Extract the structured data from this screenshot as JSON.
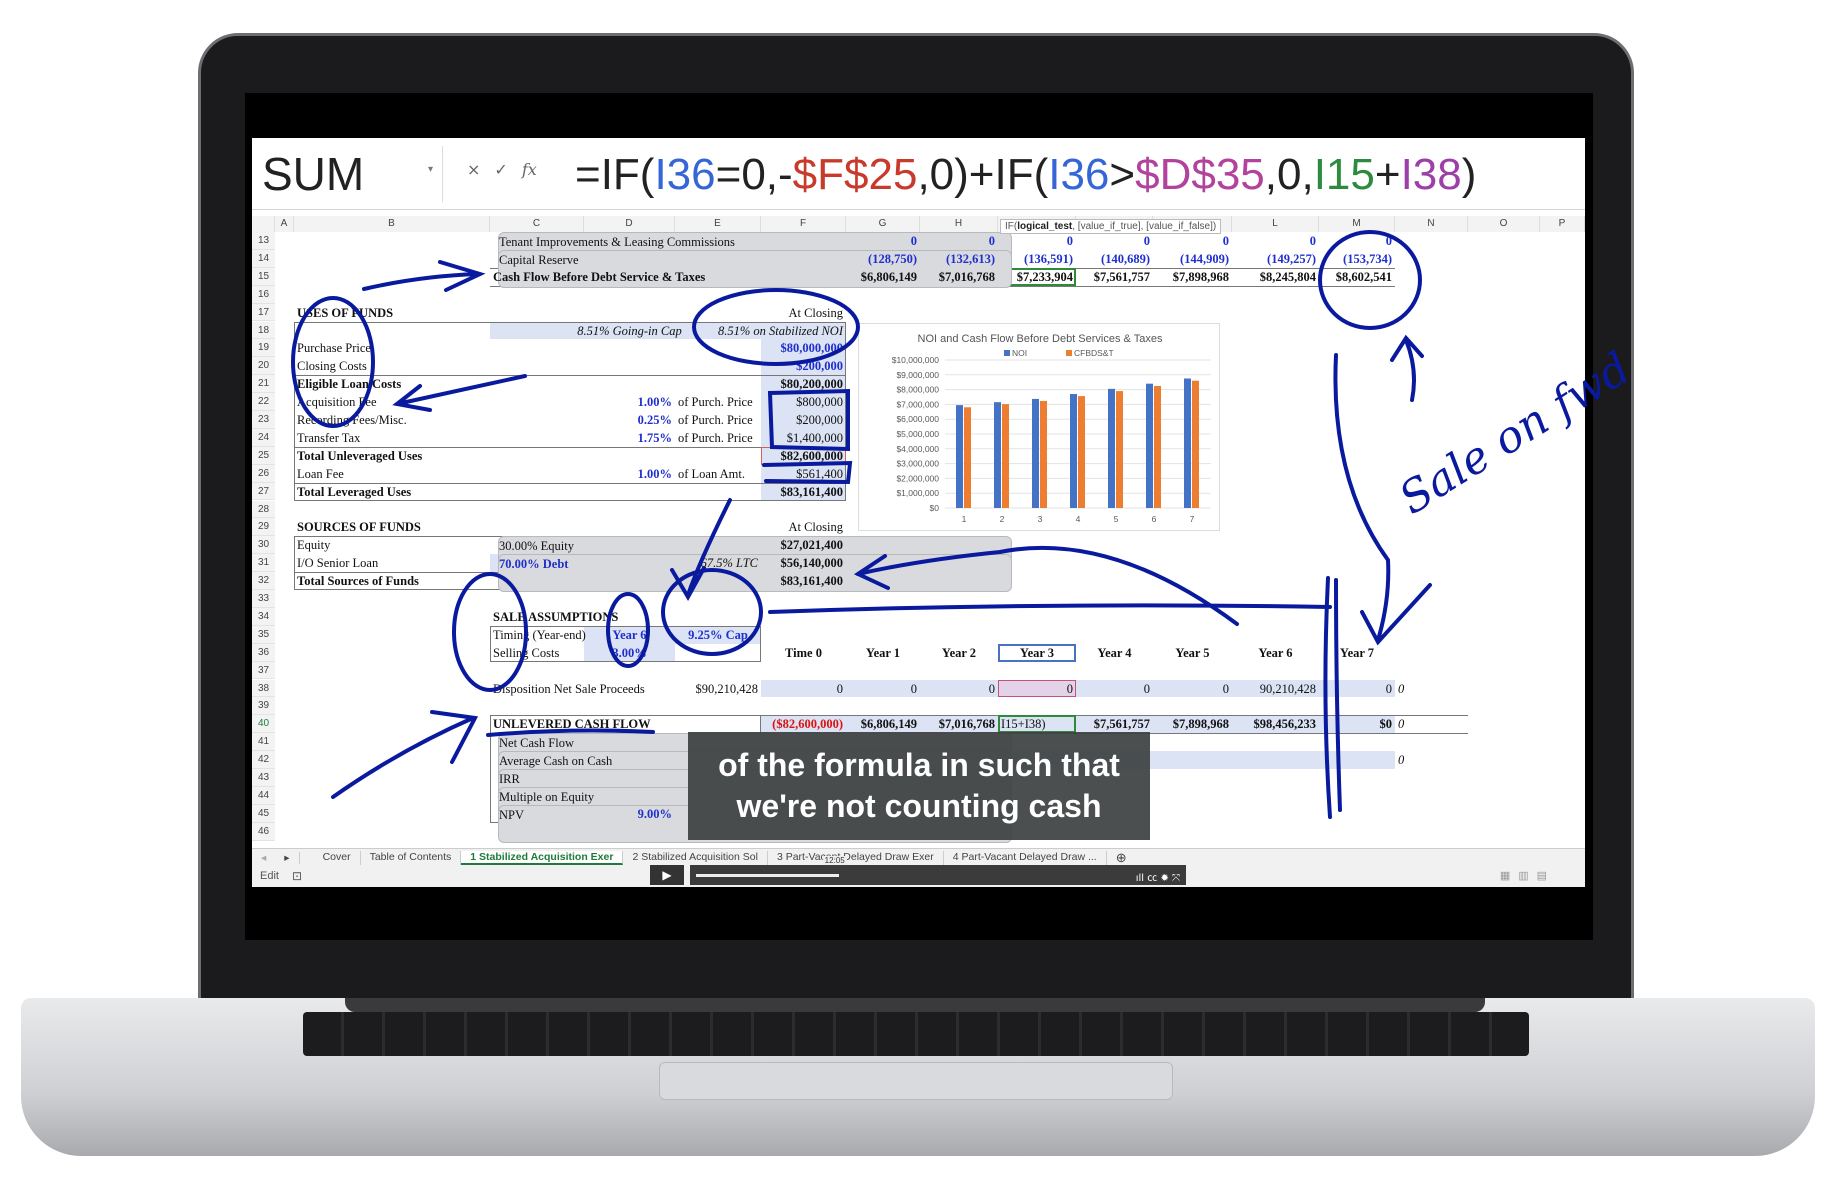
{
  "formula_bar": {
    "name_box": "SUM",
    "cancel_icon": "×",
    "enter_icon": "✓",
    "fx_label": "fx",
    "formula_parts": [
      {
        "t": "=IF(",
        "c": "#222222"
      },
      {
        "t": "I36",
        "c": "#3566d6"
      },
      {
        "t": "=0,-",
        "c": "#222222"
      },
      {
        "t": "$F$25",
        "c": "#c83a2c"
      },
      {
        "t": ",0)+IF(",
        "c": "#222222"
      },
      {
        "t": "I36",
        "c": "#3566d6"
      },
      {
        "t": ">",
        "c": "#222222"
      },
      {
        "t": "$D$35",
        "c": "#b2429c"
      },
      {
        "t": ",0,",
        "c": "#222222"
      },
      {
        "t": "I15",
        "c": "#2d8a3e"
      },
      {
        "t": "+",
        "c": "#222222"
      },
      {
        "t": "I38",
        "c": "#9c3fa8"
      },
      {
        "t": ")",
        "c": "#222222"
      }
    ],
    "tooltip_fn": "IF(",
    "tooltip_bold": "logical_test",
    "tooltip_rest": ", [value_if_true], [value_if_false])"
  },
  "columns": [
    "A",
    "B",
    "C",
    "D",
    "E",
    "F",
    "G",
    "H",
    "I",
    "J",
    "K",
    "L",
    "M",
    "N",
    "O",
    "P"
  ],
  "rows": [
    13,
    14,
    15,
    16,
    17,
    18,
    19,
    20,
    21,
    22,
    23,
    24,
    25,
    26,
    27,
    28,
    29,
    30,
    31,
    32,
    33,
    34,
    35,
    36,
    37,
    38,
    39,
    40,
    41,
    42,
    43,
    44,
    45,
    46
  ],
  "cells": [
    {
      "ref": "C13",
      "text": "Tenant Improvements & Leasing Commissions",
      "cls": "pad"
    },
    {
      "ref": "G13",
      "text": "0",
      "cls": "b bl r"
    },
    {
      "ref": "H13",
      "text": "0",
      "cls": "b bl r"
    },
    {
      "ref": "I13",
      "text": "0",
      "cls": "b bl r"
    },
    {
      "ref": "J13",
      "text": "0",
      "cls": "b bl r"
    },
    {
      "ref": "K13",
      "text": "0",
      "cls": "b bl r"
    },
    {
      "ref": "L13",
      "text": "0",
      "cls": "b bl r"
    },
    {
      "ref": "M13",
      "text": "0",
      "cls": "b bl r"
    },
    {
      "ref": "C14",
      "text": "Capital Reserve",
      "cls": "pad"
    },
    {
      "ref": "G14",
      "text": "(128,750)",
      "cls": "b bl r"
    },
    {
      "ref": "H14",
      "text": "(132,613)",
      "cls": "b bl r"
    },
    {
      "ref": "I14",
      "text": "(136,591)",
      "cls": "b bl r"
    },
    {
      "ref": "J14",
      "text": "(140,689)",
      "cls": "b bl r"
    },
    {
      "ref": "K14",
      "text": "(144,909)",
      "cls": "b bl r"
    },
    {
      "ref": "L14",
      "text": "(149,257)",
      "cls": "b bl r"
    },
    {
      "ref": "M14",
      "text": "(153,734)",
      "cls": "b bl r"
    },
    {
      "ref": "C15",
      "text": "Cash Flow Before Debt Service & Taxes",
      "cls": "b"
    },
    {
      "ref": "G15",
      "text": "$6,806,149",
      "cls": "b r"
    },
    {
      "ref": "H15",
      "text": "$7,016,768",
      "cls": "b r"
    },
    {
      "ref": "I15",
      "text": "$7,233,904",
      "cls": "b r"
    },
    {
      "ref": "J15",
      "text": "$7,561,757",
      "cls": "b r"
    },
    {
      "ref": "K15",
      "text": "$7,898,968",
      "cls": "b r"
    },
    {
      "ref": "L15",
      "text": "$8,245,804",
      "cls": "b r"
    },
    {
      "ref": "M15",
      "text": "$8,602,541",
      "cls": "b r"
    },
    {
      "ref": "B17",
      "text": "USES OF FUNDS",
      "cls": "b"
    },
    {
      "ref": "F17",
      "text": "At Closing",
      "cls": "r"
    },
    {
      "ref": "D18",
      "text": "8.51% Going-in Cap",
      "cls": "i c"
    },
    {
      "ref": "F18",
      "text": "8.51% on Stabilized NOI",
      "cls": "i r"
    },
    {
      "ref": "B19",
      "text": "Purchase Price",
      "cls": ""
    },
    {
      "ref": "F19",
      "text": "$80,000,000",
      "cls": "b bl r"
    },
    {
      "ref": "B20",
      "text": "Closing Costs",
      "cls": ""
    },
    {
      "ref": "F20",
      "text": "$200,000",
      "cls": "b bl r"
    },
    {
      "ref": "B21",
      "text": "Eligible Loan Costs",
      "cls": "b"
    },
    {
      "ref": "F21",
      "text": "$80,200,000",
      "cls": "b r"
    },
    {
      "ref": "B22",
      "text": "Acquisition Fee",
      "cls": ""
    },
    {
      "ref": "D22",
      "text": "1.00%",
      "cls": "b bl r"
    },
    {
      "ref": "E22",
      "text": "of Purch. Price",
      "cls": ""
    },
    {
      "ref": "F22",
      "text": "$800,000",
      "cls": "r"
    },
    {
      "ref": "B23",
      "text": "Recording Fees/Misc.",
      "cls": ""
    },
    {
      "ref": "D23",
      "text": "0.25%",
      "cls": "b bl r"
    },
    {
      "ref": "E23",
      "text": "of Purch. Price",
      "cls": ""
    },
    {
      "ref": "F23",
      "text": "$200,000",
      "cls": "r"
    },
    {
      "ref": "B24",
      "text": "Transfer Tax",
      "cls": ""
    },
    {
      "ref": "D24",
      "text": "1.75%",
      "cls": "b bl r"
    },
    {
      "ref": "E24",
      "text": "of Purch. Price",
      "cls": ""
    },
    {
      "ref": "F24",
      "text": "$1,400,000",
      "cls": "r"
    },
    {
      "ref": "B25",
      "text": "Total Unleveraged Uses",
      "cls": "b"
    },
    {
      "ref": "F25",
      "text": "$82,600,000",
      "cls": "b r"
    },
    {
      "ref": "B26",
      "text": "Loan Fee",
      "cls": ""
    },
    {
      "ref": "D26",
      "text": "1.00%",
      "cls": "b bl r"
    },
    {
      "ref": "E26",
      "text": "of Loan Amt.",
      "cls": ""
    },
    {
      "ref": "F26",
      "text": "$561,400",
      "cls": "r"
    },
    {
      "ref": "B27",
      "text": "Total Leveraged Uses",
      "cls": "b"
    },
    {
      "ref": "F27",
      "text": "$83,161,400",
      "cls": "b r"
    },
    {
      "ref": "B29",
      "text": "SOURCES OF FUNDS",
      "cls": "b"
    },
    {
      "ref": "F29",
      "text": "At Closing",
      "cls": "r"
    },
    {
      "ref": "B30",
      "text": "Equity",
      "cls": ""
    },
    {
      "ref": "C30",
      "text": "30.00% Equity",
      "cls": "pad"
    },
    {
      "ref": "F30",
      "text": "$27,021,400",
      "cls": "b r"
    },
    {
      "ref": "B31",
      "text": "I/O Senior Loan",
      "cls": ""
    },
    {
      "ref": "C31",
      "text": "70.00% Debt",
      "cls": "b bl pad"
    },
    {
      "ref": "E31",
      "text": "67.5% LTC",
      "cls": "i r"
    },
    {
      "ref": "F31",
      "text": "$56,140,000",
      "cls": "b r"
    },
    {
      "ref": "B32",
      "text": "Total Sources of Funds",
      "cls": "b"
    },
    {
      "ref": "F32",
      "text": "$83,161,400",
      "cls": "b r"
    },
    {
      "ref": "C34",
      "text": "SALE ASSUMPTIONS",
      "cls": "b"
    },
    {
      "ref": "C35",
      "text": "Timing (Year-end)",
      "cls": ""
    },
    {
      "ref": "D35",
      "text": "Year 6",
      "cls": "b bl c"
    },
    {
      "ref": "E35",
      "text": "9.25% Cap",
      "cls": "b bl c"
    },
    {
      "ref": "C36",
      "text": "Selling Costs",
      "cls": ""
    },
    {
      "ref": "D36",
      "text": "3.00%",
      "cls": "b bl c"
    },
    {
      "ref": "F36",
      "text": "Time 0",
      "cls": "b c"
    },
    {
      "ref": "G36",
      "text": "Year 1",
      "cls": "b c"
    },
    {
      "ref": "H36",
      "text": "Year 2",
      "cls": "b c"
    },
    {
      "ref": "I36",
      "text": "Year 3",
      "cls": "b c"
    },
    {
      "ref": "J36",
      "text": "Year 4",
      "cls": "b c"
    },
    {
      "ref": "K36",
      "text": "Year 5",
      "cls": "b c"
    },
    {
      "ref": "L36",
      "text": "Year 6",
      "cls": "b c"
    },
    {
      "ref": "M36",
      "text": "Year 7",
      "cls": "b c"
    },
    {
      "ref": "C38",
      "text": "Disposition Net Sale Proceeds",
      "cls": ""
    },
    {
      "ref": "E38",
      "text": "$90,210,428",
      "cls": "r"
    },
    {
      "ref": "F38",
      "text": "0",
      "cls": "r"
    },
    {
      "ref": "G38",
      "text": "0",
      "cls": "r"
    },
    {
      "ref": "H38",
      "text": "0",
      "cls": "r"
    },
    {
      "ref": "I38",
      "text": "0",
      "cls": "r"
    },
    {
      "ref": "J38",
      "text": "0",
      "cls": "r"
    },
    {
      "ref": "K38",
      "text": "0",
      "cls": "r"
    },
    {
      "ref": "L38",
      "text": "90,210,428",
      "cls": "r"
    },
    {
      "ref": "M38",
      "text": "0",
      "cls": "r"
    },
    {
      "ref": "N38",
      "text": "0",
      "cls": "i"
    },
    {
      "ref": "C40",
      "text": "UNLEVERED CASH FLOW",
      "cls": "b"
    },
    {
      "ref": "F40",
      "text": "($82,600,000)",
      "cls": "b red r"
    },
    {
      "ref": "G40",
      "text": "$6,806,149",
      "cls": "b r"
    },
    {
      "ref": "H40",
      "text": "$7,016,768",
      "cls": "b r"
    },
    {
      "ref": "I40",
      "text": "I15+I38)",
      "cls": ""
    },
    {
      "ref": "J40",
      "text": "$7,561,757",
      "cls": "b r"
    },
    {
      "ref": "K40",
      "text": "$7,898,968",
      "cls": "b r"
    },
    {
      "ref": "L40",
      "text": "$98,456,233",
      "cls": "b r"
    },
    {
      "ref": "M40",
      "text": "$0",
      "cls": "b r"
    },
    {
      "ref": "N40",
      "text": "0",
      "cls": "i"
    },
    {
      "ref": "C41",
      "text": "Net Cash Flow",
      "cls": "pad"
    },
    {
      "ref": "C42",
      "text": "Average Cash on Cash",
      "cls": "pad"
    },
    {
      "ref": "N42",
      "text": "0",
      "cls": "i"
    },
    {
      "ref": "C43",
      "text": "IRR",
      "cls": "pad"
    },
    {
      "ref": "C44",
      "text": "Multiple on Equity",
      "cls": "pad"
    },
    {
      "ref": "C45",
      "text": "NPV",
      "cls": "pad"
    },
    {
      "ref": "D45",
      "text": "9.00%",
      "cls": "b bl r"
    }
  ],
  "chart_data": {
    "type": "bar",
    "title": "NOI and Cash Flow Before Debt Services & Taxes",
    "categories": [
      "1",
      "2",
      "3",
      "4",
      "5",
      "6",
      "7"
    ],
    "series": [
      {
        "name": "NOI",
        "color": "#4472c4",
        "values": [
          6950000,
          7150000,
          7370000,
          7700000,
          8050000,
          8400000,
          8750000
        ]
      },
      {
        "name": "CFBDS&T",
        "color": "#ed7d31",
        "values": [
          6806149,
          7016768,
          7233904,
          7561757,
          7898968,
          8245804,
          8602541
        ]
      }
    ],
    "ylim": [
      0,
      10000000
    ],
    "yticks": [
      "$0",
      "$1,000,000",
      "$2,000,000",
      "$3,000,000",
      "$4,000,000",
      "$5,000,000",
      "$6,000,000",
      "$7,000,000",
      "$8,000,000",
      "$9,000,000",
      "$10,000,000"
    ],
    "grid": true,
    "legend": "top"
  },
  "sheet_tabs": {
    "nav_prev": "◂",
    "nav_next": "▸",
    "tabs": [
      "Cover",
      "Table of Contents",
      "1 Stabilized Acquisition Exer",
      "2 Stabilized Acquisition Sol",
      "3 Part-Vacant Delayed Draw Exer",
      "4 Part-Vacant Delayed Draw ..."
    ],
    "active": 2,
    "add_icon": "⊕"
  },
  "status_bar": {
    "mode": "Edit"
  },
  "video": {
    "play_icon": "▶",
    "time": "12:05",
    "progress": 0.29,
    "controls": "ıll ㏄ ✹ ⤧"
  },
  "caption": {
    "line1": "of the formula in such that",
    "line2": "we're not counting cash"
  },
  "annotations": {
    "handwriting": "Sale on fwd",
    "pen_color": "#0a1a9e"
  }
}
